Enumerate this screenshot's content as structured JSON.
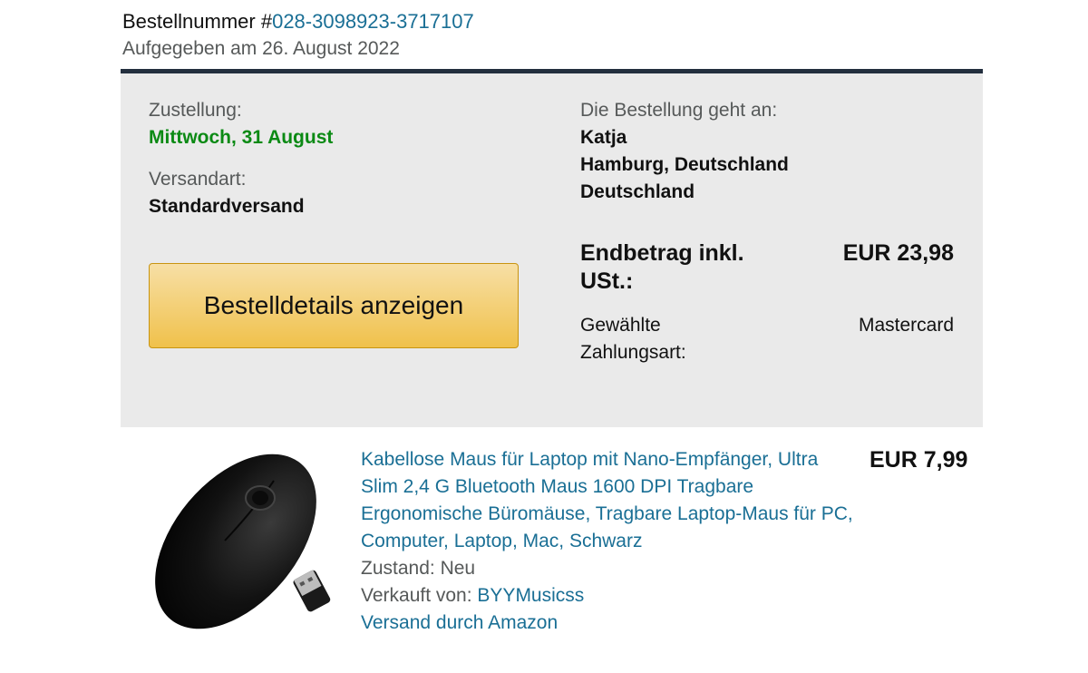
{
  "order": {
    "number_label": "Bestellnummer #",
    "number": "028-3098923-3717107",
    "placed_text": "Aufgegeben am 26. August 2022"
  },
  "delivery": {
    "label": "Zustellung:",
    "date": "Mittwoch, 31 August",
    "method_label": "Versandart:",
    "method": "Standardversand"
  },
  "details_button": {
    "label": "Bestelldetails anzeigen"
  },
  "recipient": {
    "label": "Die Bestellung geht an:",
    "name": "Katja",
    "city": "Hamburg, Deutschland",
    "country": "Deutschland"
  },
  "total": {
    "label": "Endbetrag inkl. USt.:",
    "value": "EUR 23,98"
  },
  "payment": {
    "label": "Gewählte Zahlungsart:",
    "value": "Mastercard"
  },
  "item": {
    "image_icon": "wireless-mouse-image",
    "title": "Kabellose Maus für Laptop mit Nano-Empfänger, Ultra Slim 2,4 G Bluetooth Maus 1600 DPI Tragbare Ergonomische Büromäuse, Tragbare Laptop-Maus für PC, Computer, Laptop, Mac, Schwarz",
    "condition_label": "Zustand:",
    "condition": "Neu",
    "seller_label": "Verkauft von:",
    "seller": "BYYMusicss",
    "shipping": "Versand durch Amazon",
    "price": "EUR 7,99"
  },
  "colors": {
    "link": "#1a6f95",
    "delivery_green": "#0b8a14",
    "panel_bg": "#eaeaea",
    "panel_border": "#232f3e",
    "button_yellow": "#f0c14b"
  }
}
